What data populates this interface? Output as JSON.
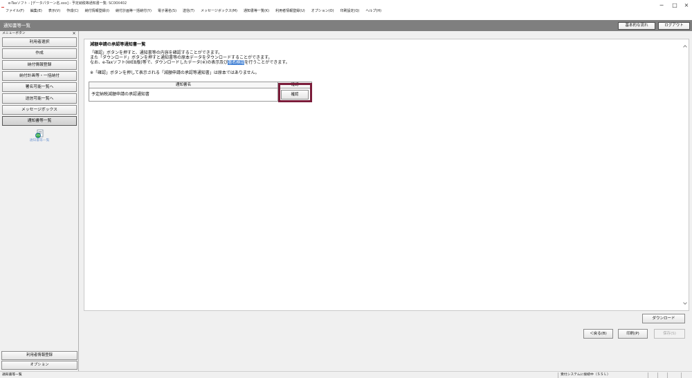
{
  "window": {
    "title": "e-Taxソフト - [データパターン名.xxx] - 予定納税等通知書一覧: SC00X402",
    "icon": "etax-app-icon",
    "minimize": "−",
    "maximize": "□",
    "close": "×"
  },
  "menubar": {
    "items": [
      "ファイル(F)",
      "編集(E)",
      "表示(V)",
      "作成(C)",
      "納付情報登録(I)",
      "納付計画等一括納付(Y)",
      "電子署名(S)",
      "送信(T)",
      "メッセージボックス(M)",
      "通知書等一覧(K)",
      "利用者情報登録(U)",
      "オプション(O)",
      "印刷設定(Q)",
      "ヘルプ(H)"
    ]
  },
  "header": {
    "title": "通知書等一覧",
    "basic_flow": "基本的な流れ",
    "logout": "ログアウト"
  },
  "sidebar": {
    "title": "メニューボタン",
    "close": "×",
    "items": [
      "利用者選択",
      "作成",
      "納付情報登録",
      "納付計画等・一括納付",
      "署名可能一覧へ",
      "送信可能一覧へ",
      "メッセージボックス",
      "通知書等一覧"
    ],
    "selected_index": 7,
    "shortcut": {
      "icon": "notice-list-icon",
      "label": "通知書等一覧"
    },
    "bottom_items": [
      "利用者情報登録",
      "オプション"
    ]
  },
  "content": {
    "title": "減額申請の承認等通知書一覧",
    "lines": [
      "「確認」ボタンを押すと、通知書等の内容を確認することができます。",
      "また「ダウンロード」ボタンを押すと通知書等の原本データをダウンロードすることができます。"
    ],
    "line3": {
      "before": "なお、e-Taxソフト(WEB版)等で、ダウンロードしたデータ(※)の表示及び",
      "link": "署名検証",
      "after": "を行うことができます。"
    },
    "note": "※「確認」ボタンを押して表示される「減額申請の承認等通知書」は原本ではありません。",
    "table": {
      "headers": [
        "通知書名",
        "確認"
      ],
      "rows": [
        {
          "name": "予定納税減額申請の承認通知書",
          "action": "確認"
        }
      ]
    },
    "scrollbar": {
      "up_icon": "scroll-up-icon",
      "down_icon": "scroll-down-icon"
    }
  },
  "actions": {
    "download": "ダウンロード",
    "back": "＜戻る(B)",
    "print": "印刷(P)",
    "save": "保存(S)",
    "save_enabled": false
  },
  "statusbar": {
    "left": "通知書等一覧",
    "connection": "受付システムに接続中（ＳＳＬ）"
  },
  "colors": {
    "header_bar": "#7f7f7f",
    "highlight_box": "#7b1c3a",
    "link_highlight": "#3f7fd4",
    "shortcut_label": "#7b9fd4"
  }
}
